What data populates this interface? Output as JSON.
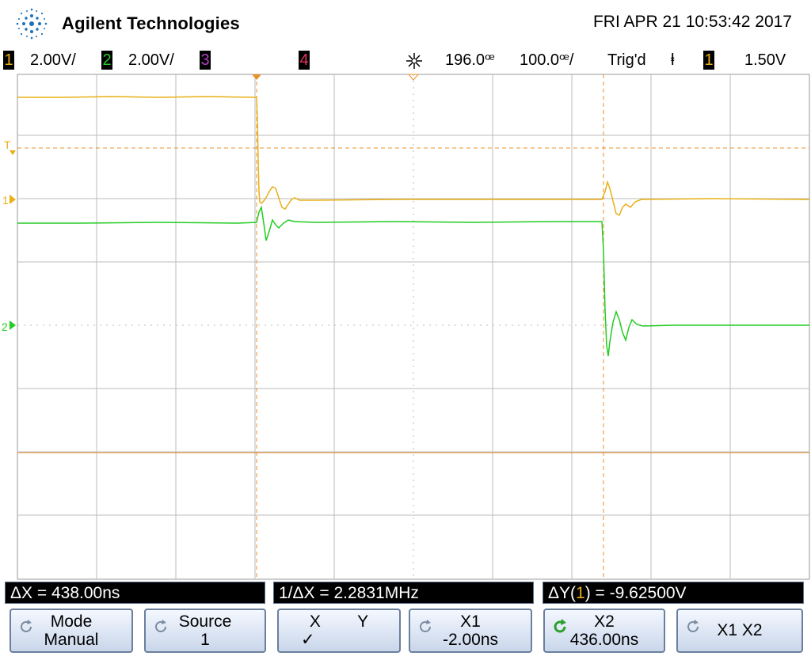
{
  "header": {
    "brand": "Agilent Technologies",
    "datetime": "FRI APR 21 10:53:42 2017"
  },
  "status": {
    "ch1_num": "1",
    "ch1_scale": "2.00V/",
    "ch2_num": "2",
    "ch2_scale": "2.00V/",
    "ch3_num": "3",
    "ch4_num": "4",
    "delay": "196.0ꟹ",
    "timebase": "100.0ꟹ/",
    "trig_state": "Trig'd",
    "trig_slope": "ⱡ",
    "trig_source": "1",
    "trig_level": "1.50V"
  },
  "screen": {
    "marker_T": "T",
    "marker_1": "1",
    "marker_2": "2"
  },
  "readouts": {
    "delta_x": "ΔX = 438.00ns",
    "inv_delta_x": "1/ΔX = 2.2831MHz",
    "delta_y_prefix": "ΔY(",
    "delta_y_src": "1",
    "delta_y_suffix": ") = -9.62500V"
  },
  "softkeys": [
    {
      "line1": "Mode",
      "line2": "Manual"
    },
    {
      "line1": "Source",
      "line2": "1"
    },
    {
      "line1": "X        Y",
      "line2": "✓"
    },
    {
      "line1": "X1",
      "line2": "-2.00ns"
    },
    {
      "line1": "X2",
      "line2": "436.00ns"
    },
    {
      "line1": "X1 X2",
      "line2": ""
    }
  ],
  "colors": {
    "ch1": "#e8b015",
    "ch2": "#22cc22",
    "ch3": "#b040c0",
    "ch4": "#e83060",
    "cursor": "#e8902a",
    "grid": "#bbbbbb"
  }
}
